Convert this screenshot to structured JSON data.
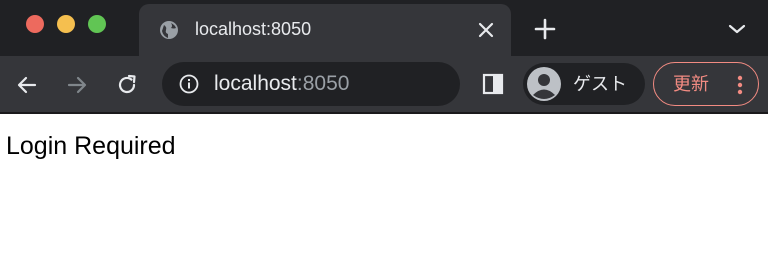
{
  "window": {
    "controls": [
      "close",
      "minimize",
      "maximize"
    ]
  },
  "tab": {
    "title": "localhost:8050",
    "icon": "globe-icon"
  },
  "toolbar": {
    "address": {
      "host": "localhost",
      "port": ":8050"
    },
    "profile_label": "ゲスト",
    "update_label": "更新"
  },
  "page": {
    "message": "Login Required"
  },
  "colors": {
    "frame": "#202124",
    "toolbar": "#35363a",
    "text": "#e8eaed",
    "muted": "#9aa0a6",
    "update_accent": "#f28b82"
  }
}
